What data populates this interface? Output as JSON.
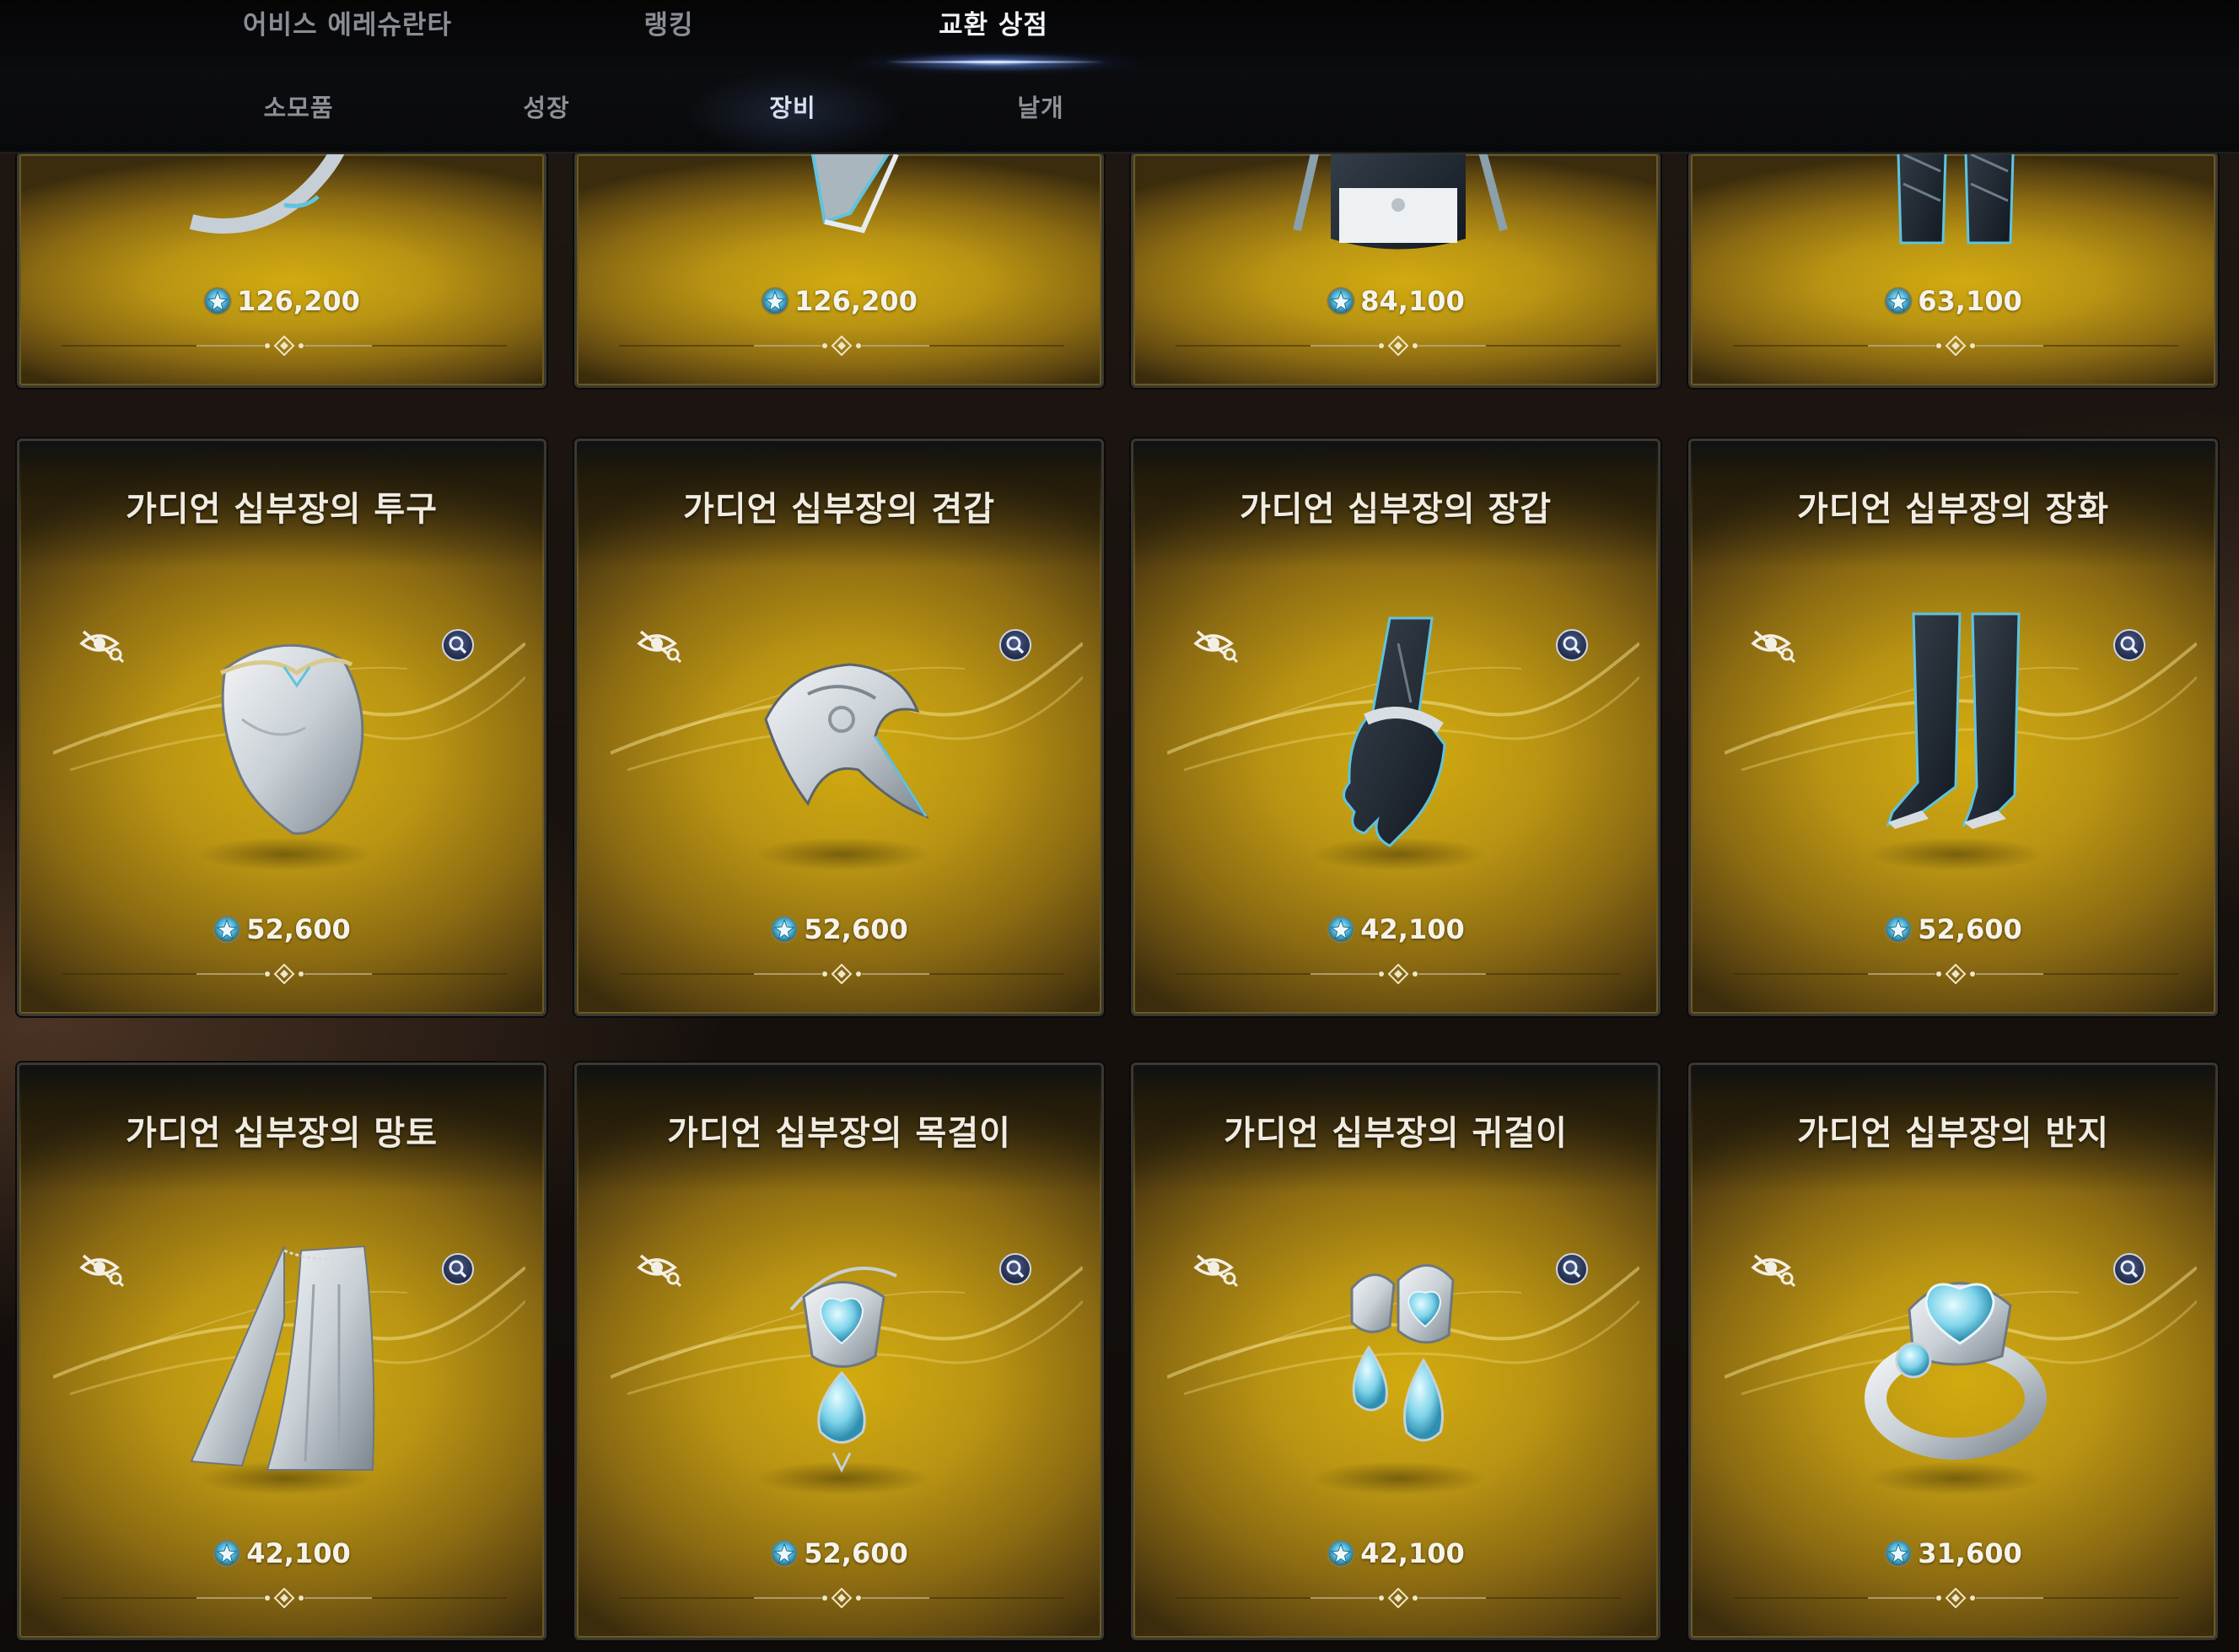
{
  "nav": {
    "tabs": [
      {
        "label": "어비스 에레슈란타"
      },
      {
        "label": "랭킹"
      },
      {
        "label": "교환 상점",
        "active": true
      }
    ]
  },
  "subnav": {
    "tabs": [
      {
        "label": "소모품"
      },
      {
        "label": "성장"
      },
      {
        "label": "장비",
        "active": true
      },
      {
        "label": "날개"
      }
    ]
  },
  "currency_icon": "blue-star-coin-icon",
  "colors": {
    "card_gold": "#c9a312",
    "price_text": "#f6f3ea",
    "nav_active": "#f2f3f7",
    "nav_inactive": "#8b8d95"
  },
  "partial_row": [
    {
      "price": "126,200",
      "icon": "weapon-icon"
    },
    {
      "price": "126,200",
      "icon": "weapon-icon"
    },
    {
      "price": "84,100",
      "icon": "chest-armor-icon"
    },
    {
      "price": "63,100",
      "icon": "leg-armor-icon"
    }
  ],
  "items": [
    {
      "name": "가디언 십부장의 투구",
      "price": "52,600",
      "icon": "helmet-icon"
    },
    {
      "name": "가디언 십부장의 견갑",
      "price": "52,600",
      "icon": "shoulder-icon"
    },
    {
      "name": "가디언 십부장의 장갑",
      "price": "42,100",
      "icon": "glove-icon"
    },
    {
      "name": "가디언 십부장의 장화",
      "price": "52,600",
      "icon": "boots-icon"
    },
    {
      "name": "가디언 십부장의 망토",
      "price": "42,100",
      "icon": "cape-icon"
    },
    {
      "name": "가디언 십부장의 목걸이",
      "price": "52,600",
      "icon": "necklace-icon"
    },
    {
      "name": "가디언 십부장의 귀걸이",
      "price": "42,100",
      "icon": "earring-icon"
    },
    {
      "name": "가디언 십부장의 반지",
      "price": "31,600",
      "icon": "ring-icon"
    }
  ]
}
